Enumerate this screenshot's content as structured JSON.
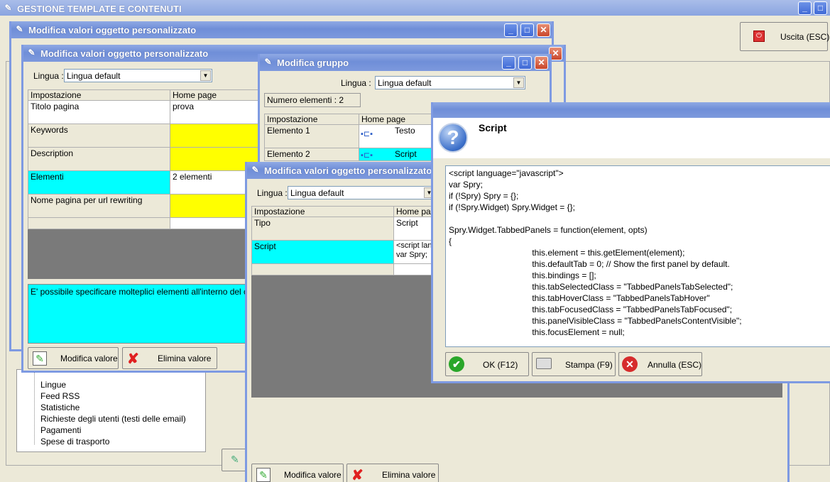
{
  "app": {
    "title": "GESTIONE TEMPLATE E CONTENUTI",
    "exit_label": "Uscita (ESC)"
  },
  "tree": {
    "items": [
      "Lingue",
      "Feed RSS",
      "Statistiche",
      "Richieste degli utenti (testi delle email)",
      "Pagamenti",
      "Spese di trasporto"
    ]
  },
  "win_back": {
    "title": "Modifica valori oggetto personalizzato"
  },
  "win_main": {
    "title": "Modifica valori oggetto personalizzato",
    "lingua_label": "Lingua :",
    "lingua_value": "Lingua default",
    "col_setting": "Impostazione",
    "col_home": "Home page",
    "rows": [
      {
        "name": "Titolo pagina",
        "value": "prova"
      },
      {
        "name": "Keywords",
        "value": ""
      },
      {
        "name": "Description",
        "value": ""
      },
      {
        "name": "Elementi",
        "value": "2 elementi"
      },
      {
        "name": "Nome pagina per url rewriting",
        "value": ""
      }
    ],
    "info_text": "E' possibile specificare molteplici elementi all'interno del corpo pa",
    "edit_label": "Modifica valore",
    "delete_label": "Elimina valore"
  },
  "win_group": {
    "title": "Modifica gruppo",
    "lingua_label": "Lingua :",
    "lingua_value": "Lingua default",
    "count_text": "Numero elementi : 2",
    "col_setting": "Impostazione",
    "col_home": "Home page",
    "rows": [
      {
        "name": "Elemento 1",
        "value": "Testo"
      },
      {
        "name": "Elemento 2",
        "value": "Script"
      }
    ]
  },
  "win_third": {
    "title": "Modifica valori oggetto personalizzato",
    "lingua_label": "Lingua :",
    "lingua_value": "Lingua default",
    "col_setting": "Impostazione",
    "col_home": "Home pag",
    "rows": [
      {
        "name": "Tipo",
        "value": "Script"
      },
      {
        "name": "Script",
        "value": "<script lang",
        "value2": "var Spry;"
      }
    ],
    "edit_label": "Modifica valore",
    "delete_label": "Elimina valore"
  },
  "dialog": {
    "title": "Script",
    "code": [
      "<script language=\"javascript\">",
      "var Spry;",
      "if (!Spry) Spry = {};",
      "if (!Spry.Widget) Spry.Widget = {};",
      "",
      "Spry.Widget.TabbedPanels = function(element, opts)",
      "{",
      "\t\tthis.element = this.getElement(element);",
      "\t\tthis.defaultTab = 0; // Show the first panel by default.",
      "\t\tthis.bindings = [];",
      "\t\tthis.tabSelectedClass = \"TabbedPanelsTabSelected\";",
      "\t\tthis.tabHoverClass = \"TabbedPanelsTabHover\"",
      "\t\tthis.tabFocusedClass = \"TabbedPanelsTabFocused\";",
      "\t\tthis.panelVisibleClass = \"TabbedPanelsContentVisible\";",
      "\t\tthis.focusElement = null;"
    ],
    "ok_label": "OK (F12)",
    "print_label": "Stampa (F9)",
    "cancel_label": "Annulla (ESC)"
  },
  "colors": {
    "yellow": "#ffff00",
    "cyan": "#00ffff",
    "titlebar": "#7e9ae2"
  }
}
